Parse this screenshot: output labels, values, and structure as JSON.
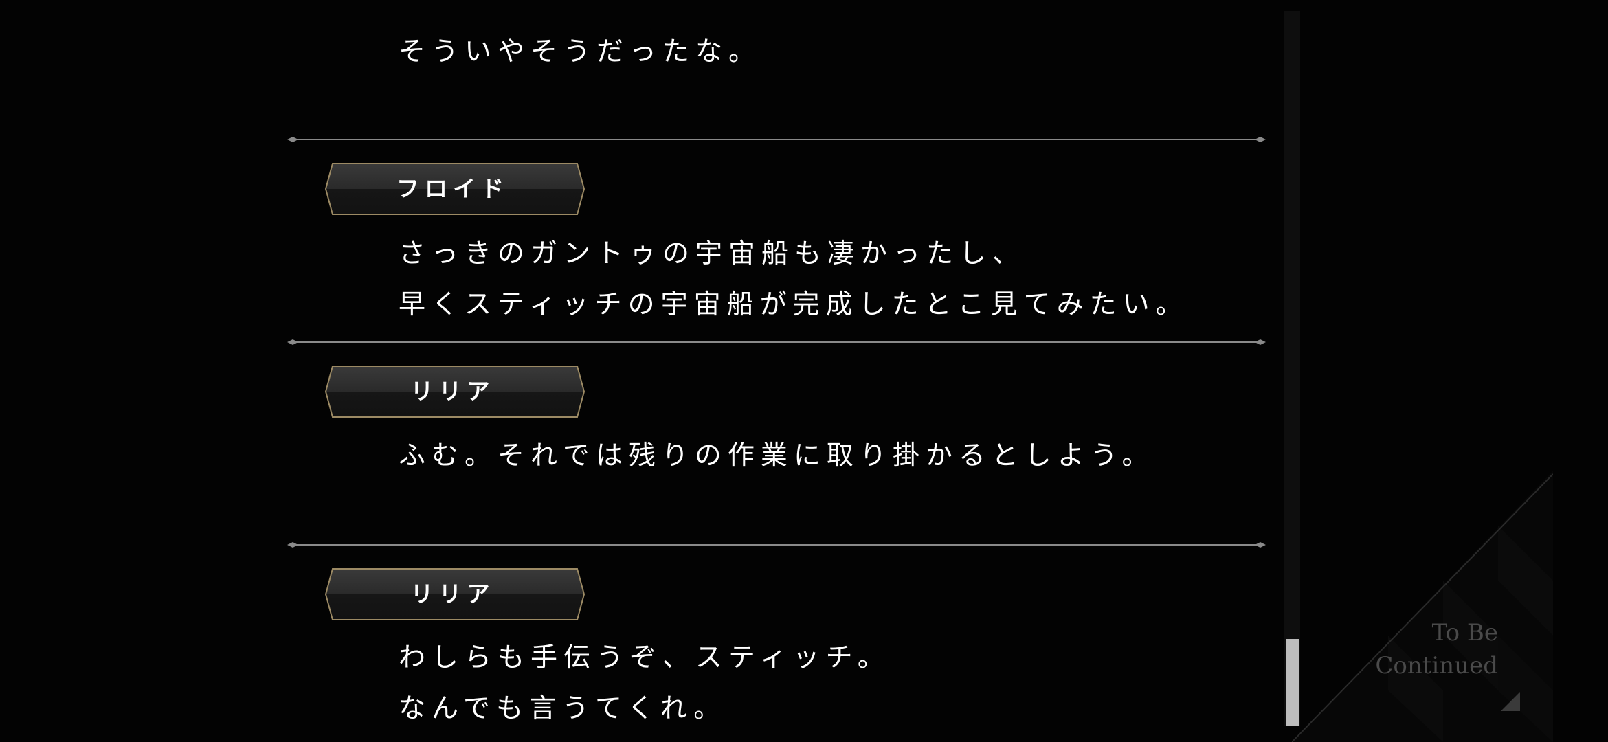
{
  "dialogue": [
    {
      "speaker": "",
      "lines": [
        "そういやそうだったな。"
      ]
    },
    {
      "speaker": "フロイド",
      "lines": [
        "さっきのガントゥの宇宙船も凄かったし、",
        "早くスティッチの宇宙船が完成したとこ見てみたい。"
      ]
    },
    {
      "speaker": "リリア",
      "lines": [
        "ふむ。それでは残りの作業に取り掛かるとしよう。"
      ]
    },
    {
      "speaker": "リリア",
      "lines": [
        "わしらも手伝うぞ、スティッチ。",
        "なんでも言うてくれ。"
      ]
    }
  ],
  "to_be_continued": {
    "line1": "To Be",
    "line2": "Continued"
  },
  "scrollbar": {
    "position": 0.95
  },
  "colors": {
    "background": "#030303",
    "text": "#ffffff",
    "divider": "#8a8a8a",
    "nameplate_border": "#9c8a64",
    "nameplate_fill": "#262626",
    "scroll_thumb": "#bdbdbd"
  }
}
